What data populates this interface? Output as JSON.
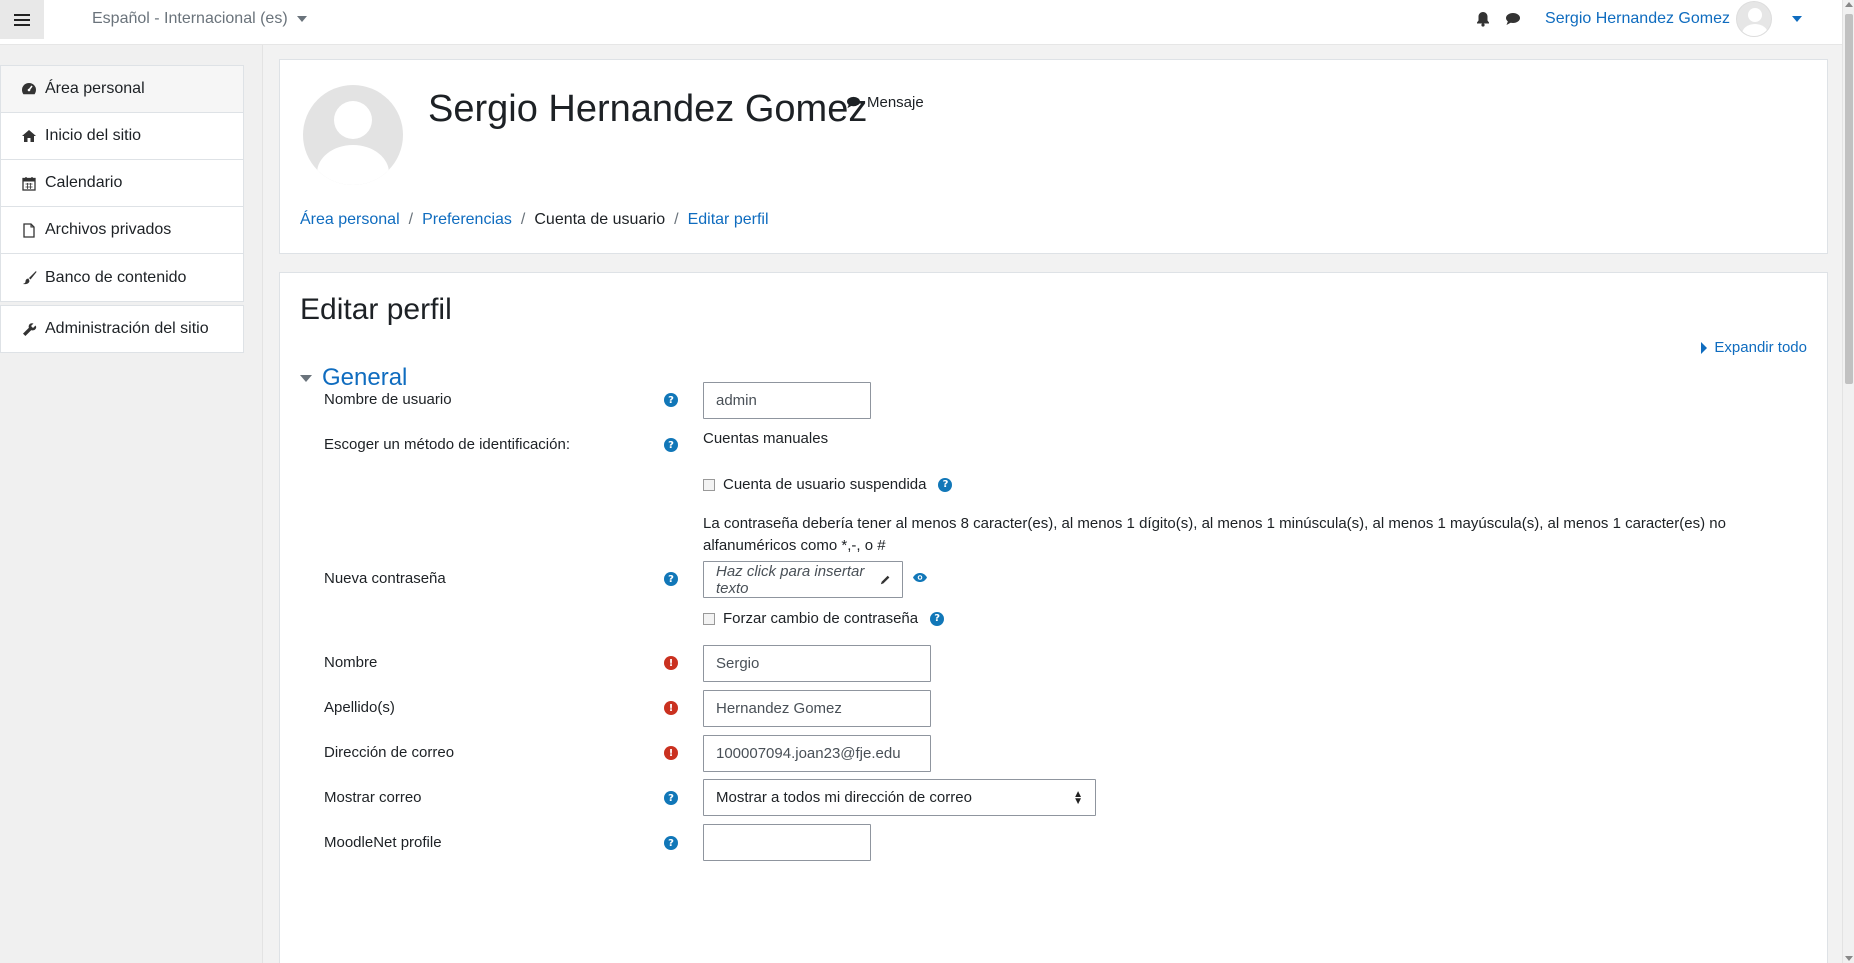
{
  "navbar": {
    "language": "Español - Internacional (es)",
    "user_name": "Sergio Hernandez Gomez"
  },
  "sidebar": {
    "items": [
      {
        "label": "Área personal",
        "icon": "dashboard-icon"
      },
      {
        "label": "Inicio del sitio",
        "icon": "home-icon"
      },
      {
        "label": "Calendario",
        "icon": "calendar-icon"
      },
      {
        "label": "Archivos privados",
        "icon": "file-icon"
      },
      {
        "label": "Banco de contenido",
        "icon": "brush-icon"
      }
    ],
    "admin": {
      "label": "Administración del sitio",
      "icon": "wrench-icon"
    }
  },
  "header": {
    "name": "Sergio Hernandez Gomez",
    "message": "Mensaje",
    "breadcrumb": [
      "Área personal",
      "Preferencias",
      "Cuenta de usuario",
      "Editar perfil"
    ]
  },
  "form": {
    "title": "Editar perfil",
    "expand_all": "Expandir todo",
    "section": "General",
    "username_label": "Nombre de usuario",
    "username_value": "admin",
    "auth_label": "Escoger un método de identificación:",
    "auth_value": "Cuentas manuales",
    "suspended_label": "Cuenta de usuario suspendida",
    "password_note": "La contraseña debería tener al menos 8 caracter(es), al menos 1 dígito(s), al menos 1 minúscula(s), al menos 1 mayúscula(s), al menos 1 caracter(es) no alfanuméricos como *,-, o #",
    "new_password_label": "Nueva contraseña",
    "new_password_placeholder": "Haz click para insertar texto",
    "force_change_label": "Forzar cambio de contraseña",
    "firstname_label": "Nombre",
    "firstname_value": "Sergio",
    "lastname_label": "Apellido(s)",
    "lastname_value": "Hernandez Gomez",
    "email_label": "Dirección de correo",
    "email_value": "100007094.joan23@fje.edu",
    "show_email_label": "Mostrar correo",
    "show_email_value": "Mostrar a todos mi dirección de correo",
    "moodlenet_label": "MoodleNet profile",
    "moodlenet_value": ""
  },
  "colors": {
    "link": "#0f6cbf",
    "help_icon": "#1177b8",
    "required_icon": "#ca3120"
  }
}
